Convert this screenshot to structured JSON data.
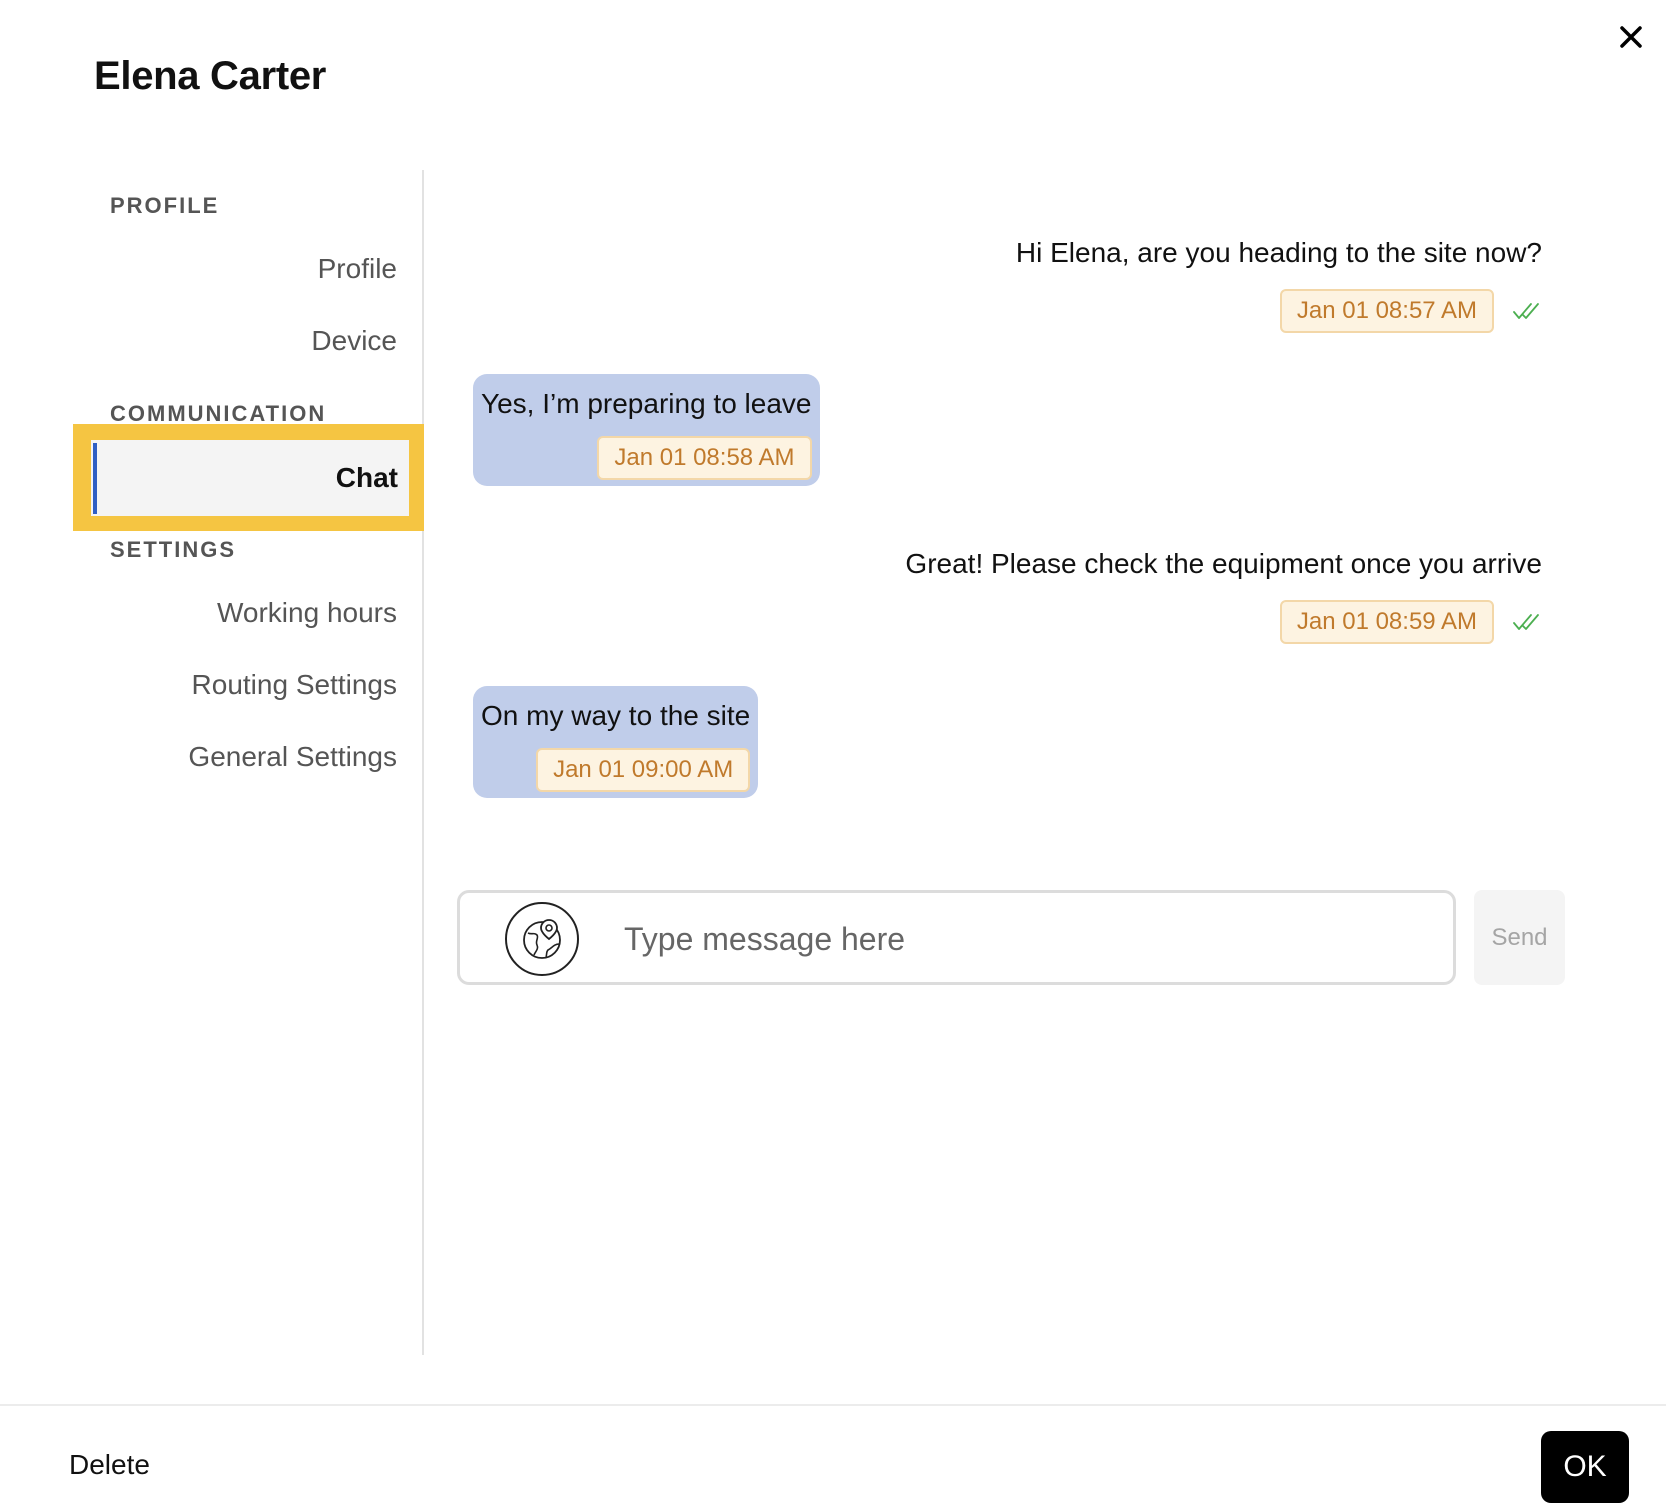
{
  "dialog": {
    "title": "Elena Carter",
    "close_icon": "close-icon"
  },
  "sidebar": {
    "sections": [
      {
        "heading": "PROFILE",
        "items": [
          {
            "label": "Profile"
          },
          {
            "label": "Device"
          }
        ]
      },
      {
        "heading": "COMMUNICATION",
        "items": [
          {
            "label": "Chat",
            "active": true
          }
        ]
      },
      {
        "heading": "SETTINGS",
        "items": [
          {
            "label": "Working hours"
          },
          {
            "label": "Routing Settings"
          },
          {
            "label": "General Settings"
          }
        ]
      }
    ]
  },
  "chat": {
    "messages": [
      {
        "direction": "outgoing",
        "text": "Hi Elena, are you heading to the site now?",
        "time": "Jan 01 08:57 AM",
        "status_icon": "double-check-icon"
      },
      {
        "direction": "incoming",
        "text": "Yes, I’m preparing to leave",
        "time": "Jan 01 08:58 AM"
      },
      {
        "direction": "outgoing",
        "text": "Great! Please check the equipment once you arrive",
        "time": "Jan 01 08:59 AM",
        "status_icon": "double-check-icon"
      },
      {
        "direction": "incoming",
        "text": "On my way to the site",
        "time": "Jan 01 09:00 AM"
      }
    ],
    "composer": {
      "placeholder": "Type message here",
      "value": "",
      "location_icon": "globe-location-icon",
      "send_label": "Send"
    }
  },
  "footer": {
    "delete_label": "Delete",
    "ok_label": "OK"
  },
  "colors": {
    "active_highlight": "#f5c542",
    "active_bar": "#2f5fc4",
    "incoming_bubble": "#c0cdea",
    "timestamp_bg": "#fdf3e1",
    "timestamp_text": "#c07a2c",
    "read_tick": "#4caf50"
  }
}
